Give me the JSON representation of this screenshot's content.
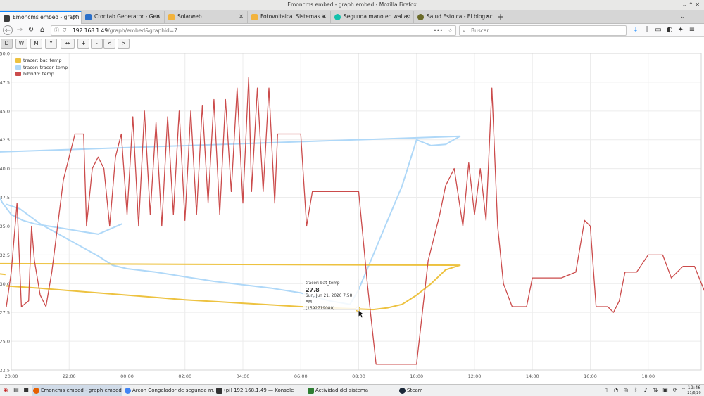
{
  "window": {
    "title": "Emoncms embed - graph embed - Mozilla Firefox"
  },
  "tabs": [
    {
      "label": "Emoncms embed - graph em",
      "color": "#3b3b3b",
      "active": true
    },
    {
      "label": "Crontab Generator - Gen",
      "color": "#2a6fc9"
    },
    {
      "label": "Solarweb",
      "color": "#f2b33d"
    },
    {
      "label": "Fotovoltaica. Sistemas a",
      "color": "#f2b33d"
    },
    {
      "label": "Segunda mano en wallap",
      "color": "#13c1ac"
    },
    {
      "label": "Salud Estoica - El blog sc",
      "color": "#6b6b2a"
    }
  ],
  "nav": {
    "url_host": "192.168.1.49",
    "url_path": "/graph/embed&graphid=7",
    "url_more": "•••",
    "search_placeholder": "Buscar"
  },
  "range_buttons": [
    "D",
    "W",
    "M",
    "Y",
    "↔",
    "+",
    "-",
    "<",
    ">"
  ],
  "chart_data": {
    "type": "line",
    "ylim": [
      22.5,
      50.0
    ],
    "yticks": [
      "22.5",
      "25.0",
      "27.5",
      "30.0",
      "32.5",
      "35.0",
      "37.5",
      "40.0",
      "42.5",
      "45.0",
      "47.5",
      "50.0"
    ],
    "xticks": [
      "20:00",
      "22:00",
      "00:00",
      "02:00",
      "04:00",
      "06:00",
      "08:00",
      "10:00",
      "12:00",
      "14:00",
      "16:00",
      "18:00"
    ],
    "x_start_hour": 20,
    "x_end_hour": 43.83,
    "legend": "top-left",
    "series": [
      {
        "name": "tracer: bat_temp",
        "color": "#edc240",
        "points": [
          [
            19.83,
            29.8
          ],
          [
            21,
            29.6
          ],
          [
            22,
            29.4
          ],
          [
            23,
            29.2
          ],
          [
            0,
            29.0
          ],
          [
            1,
            28.8
          ],
          [
            2,
            28.6
          ],
          [
            3,
            28.45
          ],
          [
            4,
            28.3
          ],
          [
            5,
            28.15
          ],
          [
            6,
            28.0
          ],
          [
            7,
            27.9
          ],
          [
            7.97,
            27.8
          ],
          [
            8.5,
            27.75
          ],
          [
            9,
            27.9
          ],
          [
            9.5,
            28.2
          ],
          [
            10,
            29.0
          ],
          [
            10.5,
            30.0
          ],
          [
            11,
            31.2
          ],
          [
            11.5,
            31.6
          ],
          [
            12,
            31.8
          ],
          [
            12.5,
            32.0
          ],
          [
            12.8,
            31.9
          ],
          [
            13,
            31.75
          ],
          [
            13.3,
            31.95
          ],
          [
            14,
            31.9
          ],
          [
            15,
            31.6
          ],
          [
            16,
            31.3
          ],
          [
            17,
            31.2
          ],
          [
            18,
            31.1
          ],
          [
            19,
            31.0
          ],
          [
            19.8,
            30.8
          ]
        ]
      },
      {
        "name": "tracer: tracer_temp",
        "color": "#afd8f8",
        "points": [
          [
            19.83,
            36.9
          ],
          [
            20.3,
            36.5
          ],
          [
            21,
            35.2
          ],
          [
            22,
            33.8
          ],
          [
            23,
            32.4
          ],
          [
            23.5,
            31.6
          ],
          [
            0,
            31.3
          ],
          [
            1,
            31.0
          ],
          [
            2,
            30.6
          ],
          [
            3,
            30.2
          ],
          [
            4,
            29.9
          ],
          [
            5,
            29.6
          ],
          [
            6,
            29.2
          ],
          [
            7,
            28.5
          ],
          [
            7.7,
            28.2
          ],
          [
            8,
            29.5
          ],
          [
            8.5,
            32.5
          ],
          [
            9,
            35.5
          ],
          [
            9.5,
            38.5
          ],
          [
            10,
            42.5
          ],
          [
            10.5,
            42.0
          ],
          [
            11,
            42.1
          ],
          [
            11.5,
            42.8
          ],
          [
            12,
            40.8
          ],
          [
            12.2,
            40.0
          ],
          [
            12.6,
            38.5
          ],
          [
            12.8,
            39.0
          ],
          [
            13,
            40.2
          ],
          [
            13.3,
            39.0
          ],
          [
            13.6,
            37.8
          ],
          [
            14,
            38.5
          ],
          [
            14.5,
            40.0
          ],
          [
            14.8,
            42.0
          ],
          [
            15,
            43.5
          ],
          [
            15.2,
            39.0
          ],
          [
            15.6,
            37.0
          ],
          [
            16,
            36.5
          ],
          [
            16.3,
            37.0
          ],
          [
            16.6,
            38.0
          ],
          [
            17,
            38.8
          ],
          [
            17.5,
            39.5
          ],
          [
            17.8,
            39.8
          ],
          [
            18,
            40.5
          ],
          [
            18.3,
            40.6
          ],
          [
            18.6,
            39.5
          ],
          [
            19,
            39.2
          ],
          [
            19.3,
            38.8
          ],
          [
            19.7,
            37.0
          ],
          [
            20,
            36.0
          ],
          [
            20.4,
            35.5
          ],
          [
            20.8,
            35.2
          ],
          [
            21.3,
            35.0
          ],
          [
            21.8,
            34.8
          ],
          [
            22.5,
            34.5
          ],
          [
            23,
            34.3
          ],
          [
            23.83,
            35.2
          ]
        ]
      },
      {
        "name": "hibrido: temp",
        "color": "#cb4b4b",
        "points": [
          [
            19.83,
            28.0
          ],
          [
            20,
            31.0
          ],
          [
            20.2,
            37.0
          ],
          [
            20.35,
            28.0
          ],
          [
            20.6,
            28.5
          ],
          [
            20.7,
            35.0
          ],
          [
            20.8,
            32.0
          ],
          [
            21,
            29.0
          ],
          [
            21.2,
            28.0
          ],
          [
            21.4,
            31.0
          ],
          [
            21.6,
            35.0
          ],
          [
            21.8,
            39.0
          ],
          [
            22,
            41.0
          ],
          [
            22.2,
            43.0
          ],
          [
            22.5,
            43.0
          ],
          [
            22.6,
            35.0
          ],
          [
            22.8,
            40.0
          ],
          [
            23,
            41.0
          ],
          [
            23.2,
            40.0
          ],
          [
            23.4,
            35.0
          ],
          [
            23.6,
            41.0
          ],
          [
            23.8,
            43.0
          ],
          [
            24,
            36.0
          ],
          [
            24.2,
            44.5
          ],
          [
            24.4,
            35.0
          ],
          [
            24.6,
            45.0
          ],
          [
            24.8,
            36.0
          ],
          [
            25,
            44.0
          ],
          [
            25.2,
            35.0
          ],
          [
            25.4,
            44.5
          ],
          [
            25.6,
            36.0
          ],
          [
            25.8,
            45.0
          ],
          [
            26,
            35.5
          ],
          [
            26.2,
            45.0
          ],
          [
            26.4,
            36.0
          ],
          [
            26.6,
            45.5
          ],
          [
            26.8,
            37.0
          ],
          [
            27,
            46.0
          ],
          [
            27.2,
            36.0
          ],
          [
            27.4,
            46.0
          ],
          [
            27.6,
            38.0
          ],
          [
            27.8,
            47.0
          ],
          [
            28,
            37.0
          ],
          [
            28.2,
            47.9
          ],
          [
            28.3,
            38.0
          ],
          [
            28.5,
            47.0
          ],
          [
            28.7,
            38.0
          ],
          [
            28.9,
            47.0
          ],
          [
            29.1,
            37.0
          ],
          [
            29.2,
            43.0
          ],
          [
            29.4,
            43.0
          ],
          [
            30,
            43.0
          ],
          [
            30.2,
            35.0
          ],
          [
            30.4,
            38.0
          ],
          [
            30.6,
            38.0
          ],
          [
            31.5,
            38.0
          ],
          [
            32,
            38.0
          ],
          [
            32.3,
            30.0
          ],
          [
            32.6,
            23.0
          ],
          [
            33,
            23.0
          ],
          [
            34,
            23.0
          ],
          [
            34.4,
            32.0
          ],
          [
            34.8,
            36.0
          ],
          [
            35,
            38.5
          ],
          [
            35.3,
            40.0
          ],
          [
            35.6,
            35.0
          ],
          [
            35.8,
            40.5
          ],
          [
            36,
            36.0
          ],
          [
            36.2,
            40.0
          ],
          [
            36.4,
            35.5
          ],
          [
            36.6,
            47.0
          ],
          [
            36.8,
            35.0
          ],
          [
            37,
            30.0
          ],
          [
            37.3,
            28.0
          ],
          [
            37.8,
            28.0
          ],
          [
            38,
            30.5
          ],
          [
            38.5,
            30.5
          ],
          [
            39,
            30.5
          ],
          [
            39.5,
            31.0
          ],
          [
            39.8,
            35.5
          ],
          [
            40,
            35.0
          ],
          [
            40.2,
            28.0
          ],
          [
            40.6,
            28.0
          ],
          [
            40.8,
            27.5
          ],
          [
            41,
            28.5
          ],
          [
            41.2,
            31.0
          ],
          [
            41.6,
            31.0
          ],
          [
            42,
            32.5
          ],
          [
            42.5,
            32.5
          ],
          [
            42.8,
            30.5
          ],
          [
            43.2,
            31.5
          ],
          [
            43.6,
            31.5
          ],
          [
            44,
            29.0
          ],
          [
            44.5,
            38.5
          ],
          [
            44.8,
            40.0
          ],
          [
            45,
            30.0
          ],
          [
            45.2,
            29.0
          ],
          [
            45.4,
            30.0
          ]
        ]
      }
    ],
    "tooltip": {
      "series": "tracer: bat_temp",
      "value": "27.8",
      "date": "Sun, Jun 21, 2020 7:58 AM",
      "timestamp": "(1592719080)"
    }
  },
  "taskbar": {
    "items": [
      {
        "label": "Emoncms embed - graph embed ...",
        "color": "#e66000",
        "active": true
      },
      {
        "label": "Arcón Congelador de segunda m...",
        "color": "#4285f4"
      },
      {
        "label": "(pi) 192.168.1.49 — Konsole",
        "color": "#333333"
      },
      {
        "label": "Actividad del sistema",
        "color": "#2e7d32"
      },
      {
        "label": "Steam",
        "color": "#1b2838"
      }
    ],
    "time": "19:46",
    "date": "21/6/20"
  }
}
